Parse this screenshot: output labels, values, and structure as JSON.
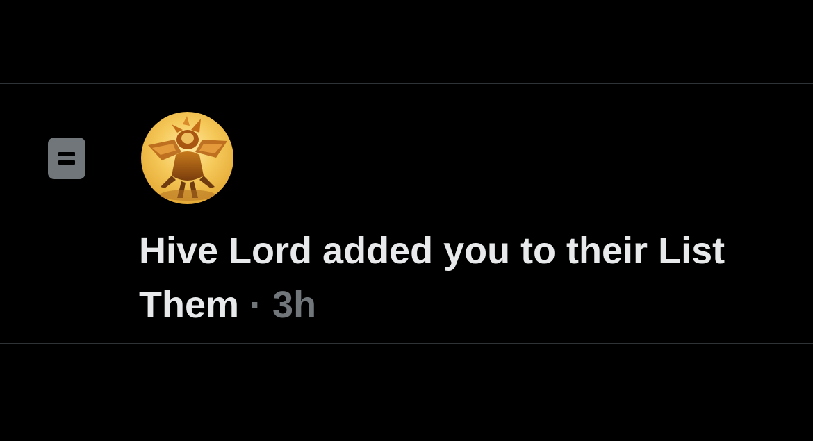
{
  "notification": {
    "icon": "list-icon",
    "avatar_icon": "hive-lord-avatar",
    "actor_name": "Hive Lord",
    "action_text": " added you to their ",
    "list_prefix": "List",
    "list_name": "Them",
    "separator": " · ",
    "time": "3h"
  },
  "colors": {
    "background": "#000000",
    "divider": "#2f3336",
    "text_primary": "#e7e9ea",
    "text_secondary": "#71767b",
    "icon_fill": "#71767b"
  }
}
